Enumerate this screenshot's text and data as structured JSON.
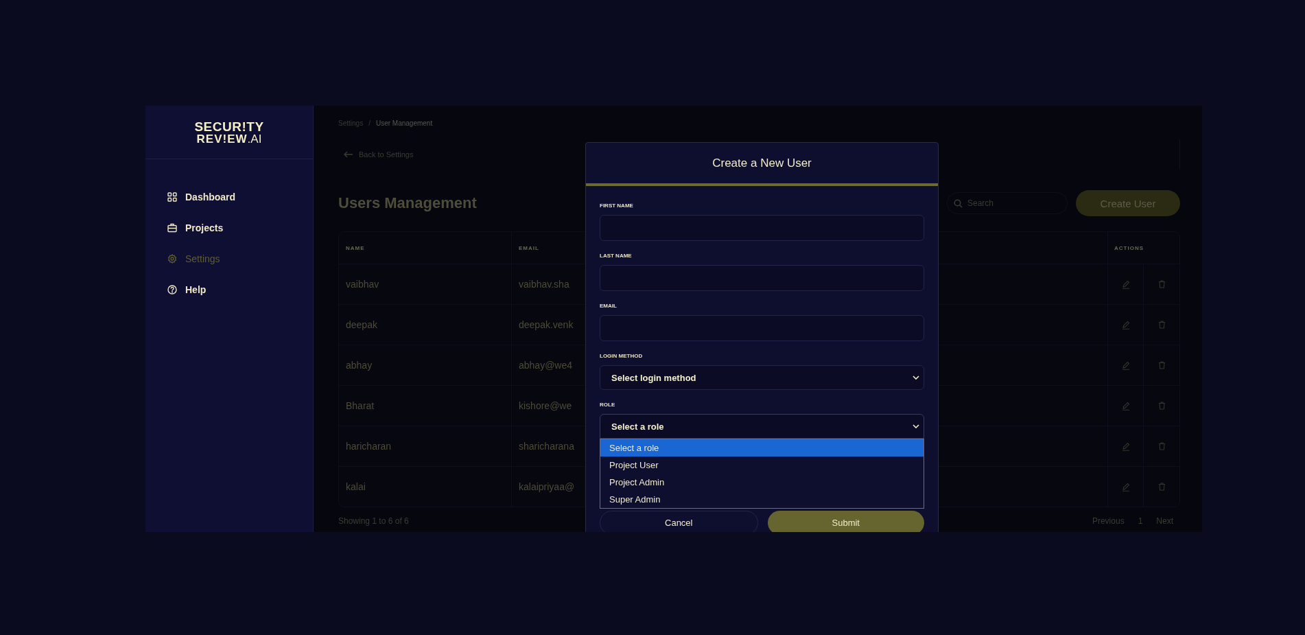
{
  "logo": {
    "line1": "SECUR!TY",
    "line2": "REV!EW",
    "suffix": ".AI"
  },
  "sidebar": {
    "items": [
      {
        "label": "Dashboard",
        "selected": false
      },
      {
        "label": "Projects",
        "selected": false
      },
      {
        "label": "Settings",
        "selected": true
      },
      {
        "label": "Help",
        "selected": false
      }
    ]
  },
  "breadcrumb": {
    "items": [
      "Settings",
      "User Management"
    ],
    "separator": "/"
  },
  "back_link": "Back to Settings",
  "page_title": "Users Management",
  "search": {
    "placeholder": "Search"
  },
  "create_button": "Create User",
  "table": {
    "columns": [
      "NAME",
      "EMAIL",
      "ACTIONS"
    ],
    "rows": [
      {
        "name": "vaibhav",
        "email": "vaibhav.sha"
      },
      {
        "name": "deepak",
        "email": "deepak.venk"
      },
      {
        "name": "abhay",
        "email": "abhay@we4"
      },
      {
        "name": "Bharat",
        "email": "kishore@we"
      },
      {
        "name": "haricharan",
        "email": "sharicharana"
      },
      {
        "name": "kalai",
        "email": "kalaipriyaa@"
      }
    ]
  },
  "footer": {
    "summary": "Showing 1 to 6 of 6",
    "pagination": [
      "Previous",
      "1",
      "Next"
    ]
  },
  "modal": {
    "title": "Create a New User",
    "fields": [
      {
        "kind": "text",
        "label": "FIRST NAME"
      },
      {
        "kind": "text",
        "label": "LAST NAME"
      },
      {
        "kind": "text",
        "label": "EMAIL"
      },
      {
        "kind": "select",
        "label": "LOGIN METHOD",
        "value": "Select login method",
        "expanded": false
      },
      {
        "kind": "select",
        "label": "ROLE",
        "value": "Select a role",
        "expanded": true,
        "options": [
          {
            "label": "Select a role",
            "selected": true
          },
          {
            "label": "Project User",
            "selected": false
          },
          {
            "label": "Project Admin",
            "selected": false
          },
          {
            "label": "Super Admin",
            "selected": false
          }
        ]
      }
    ],
    "buttons": [
      {
        "label": "Cancel",
        "kind": "secondary"
      },
      {
        "label": "Submit",
        "kind": "primary"
      }
    ]
  }
}
